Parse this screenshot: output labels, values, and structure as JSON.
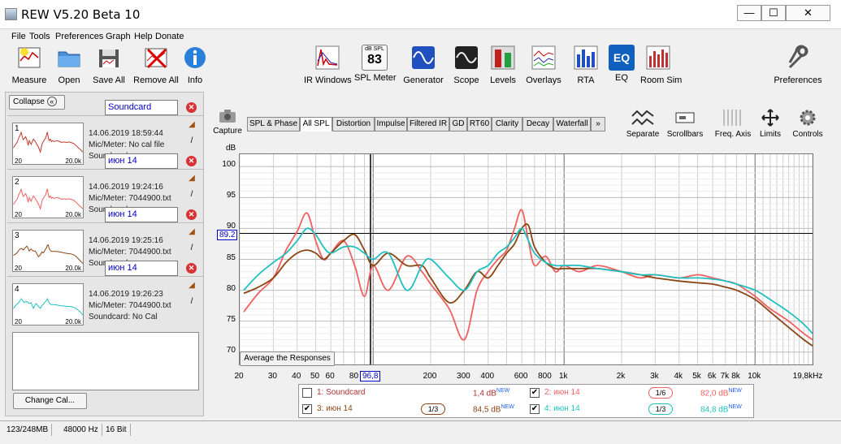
{
  "window": {
    "title": "REW V5.20 Beta 10",
    "minimize": "—",
    "maximize": "☐",
    "close": "✕"
  },
  "menu": [
    "File",
    "Tools",
    "Preferences",
    "Graph",
    "Help",
    "Donate"
  ],
  "toolbar": {
    "left": [
      "Measure",
      "Open",
      "Save All",
      "Remove All",
      "Info"
    ],
    "center": [
      "IR Windows",
      "SPL Meter",
      "Generator",
      "Scope",
      "Levels",
      "Overlays",
      "RTA",
      "EQ",
      "Room Sim"
    ],
    "spl_meter_top": "dB SPL",
    "spl_meter_value": "83",
    "eq_icon_text": "EQ",
    "right": "Preferences"
  },
  "left_panel": {
    "collapse": "Collapse",
    "measurements": [
      {
        "num": "1",
        "name": "Soundcard",
        "date": "14.06.2019 18:59:44",
        "mic": "Mic/Meter: No cal file",
        "sc": "Soundcard",
        "ax_start": "20",
        "ax_end": "20.0k",
        "color": "#c0392b"
      },
      {
        "num": "2",
        "name": "июн 14",
        "date": "14.06.2019 19:24:16",
        "mic": "Mic/Meter: 7044900.txt",
        "sc": "Soundcard",
        "ax_start": "20",
        "ax_end": "20.0k",
        "color": "#f06060"
      },
      {
        "num": "3",
        "name": "июн 14",
        "date": "14.06.2019 19:25:16",
        "mic": "Mic/Meter: 7044900.txt",
        "sc": "Soundcard",
        "ax_start": "20",
        "ax_end": "20.0k",
        "color": "#8b4513"
      },
      {
        "num": "4",
        "name": "июн 14",
        "date": "14.06.2019 19:26:23",
        "mic": "Mic/Meter: 7044900.txt",
        "sc": "Soundcard: No Cal",
        "ax_start": "20",
        "ax_end": "20.0k",
        "color": "#20c0c0"
      }
    ],
    "change_cal": "Change Cal..."
  },
  "graph": {
    "capture": "Capture",
    "tabs": [
      "SPL & Phase",
      "All SPL",
      "Distortion",
      "Impulse",
      "Filtered IR",
      "GD",
      "RT60",
      "Clarity",
      "Decay",
      "Waterfall",
      "»"
    ],
    "active_tab": "All SPL",
    "tools": [
      "Separate",
      "Scrollbars",
      "Freq. Axis",
      "Limits",
      "Controls"
    ],
    "y_unit": "dB",
    "y_ticks": [
      "100",
      "95",
      "90",
      "85",
      "80",
      "75",
      "70"
    ],
    "x_ticks": [
      "20",
      "30",
      "40",
      "50",
      "60",
      "80",
      "200",
      "300",
      "400",
      "600",
      "800",
      "1k",
      "2k",
      "3k",
      "4k",
      "5k",
      "6k",
      "7k",
      "8k",
      "10k",
      "19,8kHz"
    ],
    "cursor_y": "89.2",
    "cursor_x": "96,8",
    "average_button": "Average the Responses"
  },
  "chart_data": {
    "type": "line",
    "x_scale": "log",
    "xlim": [
      20,
      20000
    ],
    "ylim": [
      68,
      102
    ],
    "ylabel": "dB",
    "grid": true,
    "series": [
      {
        "name": "2: июн 14",
        "color": "#f06060",
        "x": [
          21,
          25,
          30,
          35,
          40,
          45,
          50,
          55,
          60,
          70,
          80,
          90,
          100,
          120,
          150,
          180,
          200,
          250,
          300,
          350,
          400,
          450,
          500,
          550,
          600,
          650,
          700,
          800,
          900,
          1000,
          1200,
          1500,
          2000,
          2500,
          3000,
          4000,
          5000,
          6000,
          7000,
          8000,
          10000,
          12000,
          15000,
          18000,
          20000
        ],
        "y": [
          76.5,
          79.5,
          82,
          86.5,
          89.5,
          92.5,
          88,
          85,
          86,
          88,
          84,
          79,
          84,
          80,
          85.5,
          83,
          81,
          77,
          72,
          80,
          83,
          85,
          86.5,
          90,
          93,
          88,
          84,
          85.5,
          83,
          84,
          83,
          84,
          83,
          82,
          82.5,
          82,
          82.5,
          82,
          81.5,
          81,
          79,
          77,
          75,
          73,
          72
        ]
      },
      {
        "name": "3: июн 14",
        "color": "#8b4513",
        "x": [
          21,
          25,
          30,
          35,
          40,
          45,
          50,
          55,
          60,
          70,
          80,
          90,
          100,
          120,
          150,
          180,
          200,
          250,
          300,
          350,
          400,
          450,
          500,
          550,
          600,
          650,
          700,
          800,
          900,
          1000,
          1200,
          1500,
          2000,
          2500,
          3000,
          4000,
          5000,
          6000,
          7000,
          8000,
          10000,
          12000,
          15000,
          18000,
          20000
        ],
        "y": [
          79.5,
          80.5,
          82,
          84.5,
          86,
          86.5,
          86,
          85,
          86,
          88,
          89,
          86.5,
          84,
          86,
          84,
          84,
          82,
          78,
          80,
          83,
          82,
          84,
          86,
          87.5,
          90,
          90.5,
          87,
          84.5,
          83.5,
          83.5,
          83.5,
          83.5,
          83,
          82.5,
          82,
          81.5,
          81.2,
          81,
          80.5,
          80,
          78.5,
          76.5,
          74,
          72,
          71
        ]
      },
      {
        "name": "4: июн 14",
        "color": "#20c0c0",
        "x": [
          21,
          25,
          30,
          35,
          40,
          45,
          50,
          55,
          60,
          70,
          80,
          90,
          100,
          120,
          150,
          180,
          200,
          250,
          300,
          350,
          400,
          450,
          500,
          550,
          600,
          650,
          700,
          800,
          900,
          1000,
          1200,
          1500,
          2000,
          2500,
          3000,
          4000,
          5000,
          6000,
          7000,
          8000,
          10000,
          12000,
          15000,
          18000,
          20000
        ],
        "y": [
          80,
          82.5,
          84.5,
          86,
          88,
          90,
          89,
          87,
          86,
          87,
          87,
          86,
          85,
          86,
          80,
          84,
          85,
          82,
          80,
          83,
          84,
          86,
          87,
          88.5,
          90,
          88,
          86,
          84.5,
          84,
          84,
          84,
          83.5,
          83,
          82.5,
          82.5,
          82,
          82,
          81.8,
          81.5,
          81,
          80,
          78.5,
          76.5,
          74.5,
          73
        ]
      }
    ]
  },
  "legend": {
    "items": [
      {
        "label": "1: Soundcard",
        "checked": false,
        "smoothing": "",
        "offset": "1,4 dB",
        "badge": "NEW",
        "color": "#b03030"
      },
      {
        "label": "2: июн 14",
        "checked": true,
        "smoothing": "1/6",
        "offset": "82,0 dB",
        "badge": "NEW",
        "color": "#f06060"
      },
      {
        "label": "3: июн 14",
        "checked": true,
        "smoothing": "1/3",
        "offset": "84,5 dB",
        "badge": "NEW",
        "color": "#8b4513"
      },
      {
        "label": "4: июн 14",
        "checked": true,
        "smoothing": "1/3",
        "offset": "84,8 dB",
        "badge": "NEW",
        "color": "#20c0c0"
      }
    ]
  },
  "status": [
    "123/248MB",
    "48000 Hz",
    "16 Bit"
  ]
}
